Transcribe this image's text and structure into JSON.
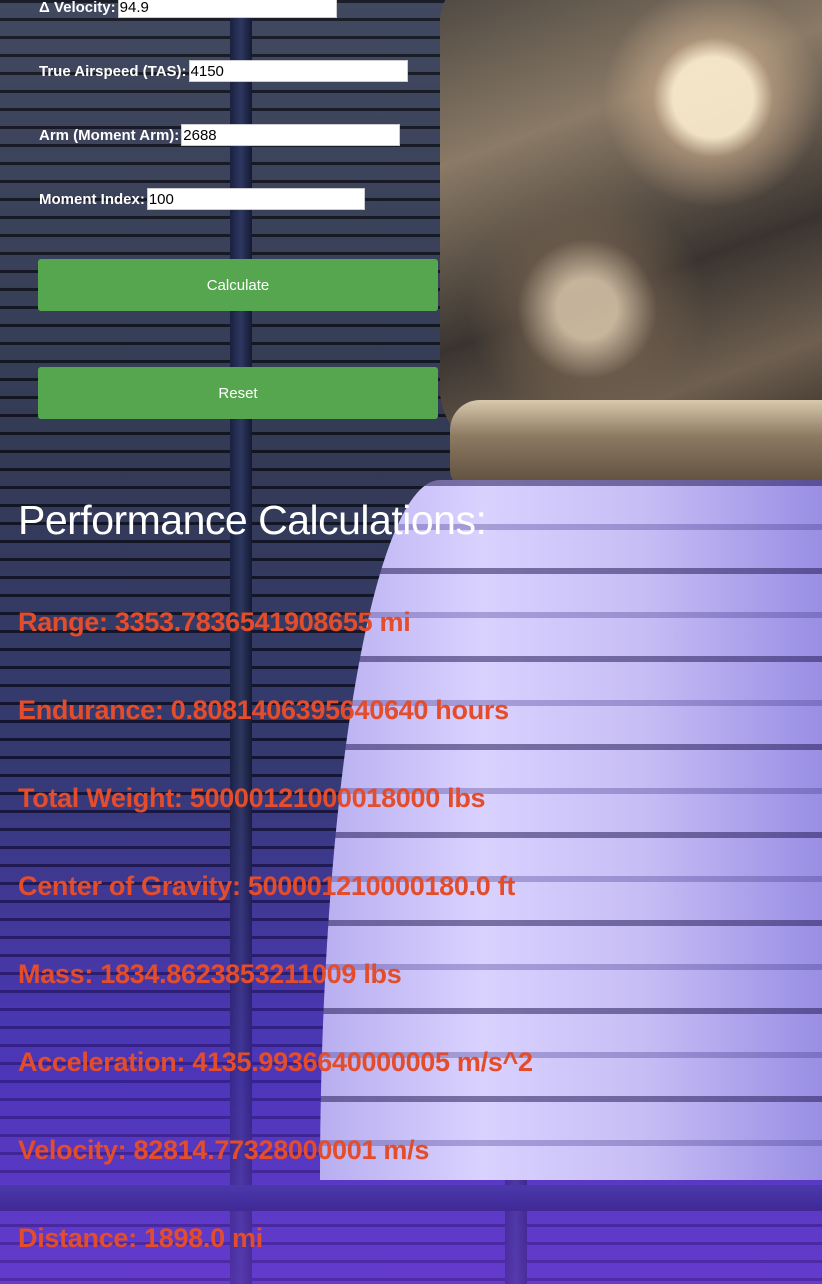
{
  "form": {
    "delta_velocity": {
      "label": "Δ Velocity:",
      "value": "94.9"
    },
    "tas": {
      "label": "True Airspeed (TAS):",
      "value": "4150"
    },
    "arm": {
      "label": "Arm (Moment Arm):",
      "value": "2688"
    },
    "moment_index": {
      "label": "Moment Index:",
      "value": "100"
    },
    "calculate_label": "Calculate",
    "reset_label": "Reset"
  },
  "results": {
    "title": "Performance Calculations:",
    "items": [
      "Range: 3353.7836541908655 mi",
      "Endurance: 0.8081406395640640 hours",
      "Total Weight: 50000121000018000 lbs",
      "Center of Gravity: 500001210000180.0 ft",
      "Mass: 1834.8623853211009 lbs",
      "Acceleration: 4135.9936640000005 m/s^2",
      "Velocity: 82814.77328000001 m/s",
      "Distance: 1898.0 mi"
    ]
  },
  "colors": {
    "button": "#56a64f",
    "result_text": "#e34d2b",
    "label_text": "#ffffff"
  }
}
